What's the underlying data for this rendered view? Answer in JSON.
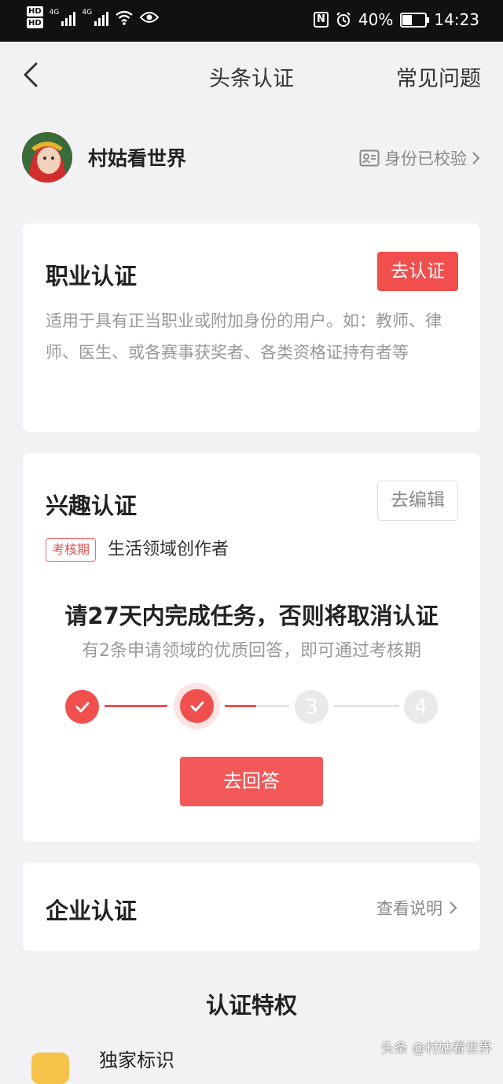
{
  "status_bar": {
    "hd1": "HD",
    "hd2": "HD",
    "net1": "4G",
    "net2": "4G",
    "battery_percent": "40%",
    "time": "14:23",
    "nfc": "N"
  },
  "nav": {
    "title": "头条认证",
    "faq": "常见问题"
  },
  "profile": {
    "username": "村姑看世界",
    "verified_text": "身份已校验"
  },
  "professional": {
    "title": "职业认证",
    "button": "去认证",
    "description": "适用于具有正当职业或附加身份的用户。如：教师、律师、医生、或各赛事获奖者、各类资格证持有者等"
  },
  "interest": {
    "title": "兴趣认证",
    "button": "去编辑",
    "tag": "考核期",
    "field": "生活领域创作者",
    "task_title": "请27天内完成任务，否则将取消认证",
    "task_subtitle": "有2条申请领域的优质回答，即可通过考核期",
    "steps": [
      {
        "label": "",
        "state": "done"
      },
      {
        "label": "",
        "state": "current"
      },
      {
        "label": "3",
        "state": "todo"
      },
      {
        "label": "4",
        "state": "todo"
      }
    ],
    "answer_button": "去回答"
  },
  "enterprise": {
    "title": "企业认证",
    "link": "查看说明"
  },
  "privileges": {
    "title": "认证特权",
    "first_item": "独家标识"
  },
  "watermark": "头条 @村姑看世界",
  "colors": {
    "accent": "#f04f4e",
    "background": "#f2f2f4",
    "card": "#ffffff"
  }
}
